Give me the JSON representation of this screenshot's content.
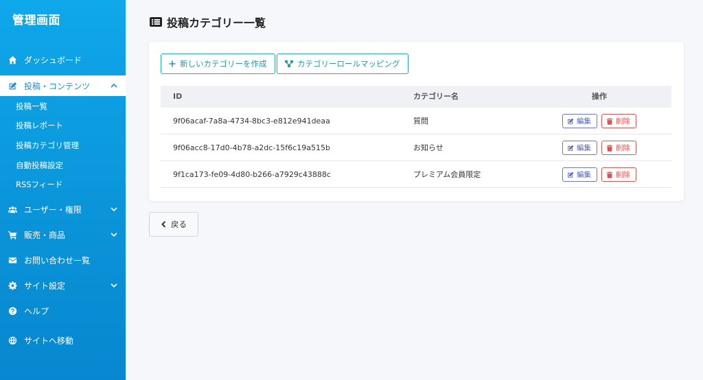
{
  "sidebar": {
    "brand": "管理画面",
    "items": [
      {
        "label": "ダッシュボード"
      },
      {
        "label": "投稿・コンテンツ"
      },
      {
        "label": "ユーザー・権限"
      },
      {
        "label": "販売・商品"
      },
      {
        "label": "お問い合わせ一覧"
      },
      {
        "label": "サイト設定"
      },
      {
        "label": "ヘルプ"
      },
      {
        "label": "サイトへ移動"
      }
    ],
    "sub_items": [
      {
        "label": "投稿一覧"
      },
      {
        "label": "投稿レポート"
      },
      {
        "label": "投稿カテゴリ管理"
      },
      {
        "label": "自動投稿設定"
      },
      {
        "label": "RSSフィード"
      }
    ]
  },
  "page": {
    "title": "投稿カテゴリー一覧",
    "create_button": "新しいカテゴリーを作成",
    "mapping_button": "カテゴリーロールマッピング",
    "back_button": "戻る"
  },
  "table": {
    "headers": {
      "id": "ID",
      "name": "カテゴリー名",
      "actions": "操作"
    },
    "edit_label": "編集",
    "delete_label": "削除",
    "rows": [
      {
        "id": "9f06acaf-7a8a-4734-8bc3-e812e941deaa",
        "name": "質問"
      },
      {
        "id": "9f06acc8-17d0-4b78-a2dc-15f6c19a515b",
        "name": "お知らせ"
      },
      {
        "id": "9f1ca173-fe09-4d80-b266-a7929c43888c",
        "name": "プレミアム会員限定"
      }
    ]
  },
  "colors": {
    "sidebar_top": "#0fa8ea",
    "sidebar_bottom": "#0787cf",
    "teal": "#1e9aa8",
    "edit": "#5560c0",
    "delete": "#d9534f"
  }
}
